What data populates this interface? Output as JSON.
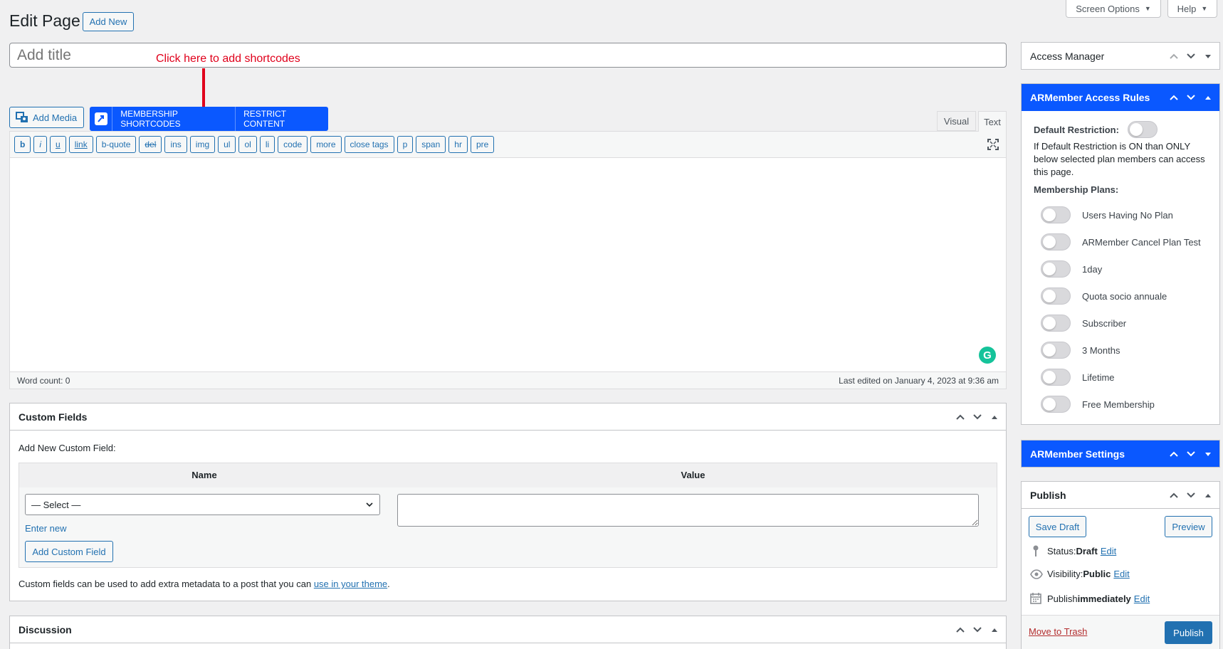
{
  "header": {
    "title": "Edit Page",
    "add_new": "Add New",
    "screen_options": "Screen Options",
    "help": "Help"
  },
  "title_input": {
    "placeholder": "Add title"
  },
  "annotation": {
    "text": "Click here to add shortcodes",
    "color": "#e0001b"
  },
  "toolbar": {
    "add_media": "Add Media",
    "membership_shortcodes": "MEMBERSHIP SHORTCODES",
    "restrict_content": "RESTRICT CONTENT",
    "tab_visual": "Visual",
    "tab_text": "Text",
    "quicktags": [
      "b",
      "i",
      "u",
      "link",
      "b-quote",
      "del",
      "ins",
      "img",
      "ul",
      "ol",
      "li",
      "code",
      "more",
      "close tags",
      "p",
      "span",
      "hr",
      "pre"
    ]
  },
  "editor": {
    "word_count": "Word count: 0",
    "last_edited": "Last edited on January 4, 2023 at 9:36 am"
  },
  "custom_fields": {
    "title": "Custom Fields",
    "add_new_label": "Add New Custom Field:",
    "col_name": "Name",
    "col_value": "Value",
    "select_value": "— Select —",
    "enter_new": "Enter new",
    "add_button": "Add Custom Field",
    "note_prefix": "Custom fields can be used to add extra metadata to a post that you can ",
    "note_link": "use in your theme",
    "note_suffix": "."
  },
  "discussion": {
    "title": "Discussion"
  },
  "access_manager": {
    "title": "Access Manager"
  },
  "access_rules": {
    "title": "ARMember Access Rules",
    "default_restriction_label": "Default Restriction:",
    "description": "If Default Restriction is ON than ONLY below selected plan members can access this page.",
    "plans_label": "Membership Plans:",
    "plans": [
      "Users Having No Plan",
      "ARMember Cancel Plan Test",
      "1day",
      "Quota socio annuale",
      "Subscriber",
      "3 Months",
      "Lifetime",
      "Free Membership"
    ]
  },
  "armember_settings": {
    "title": "ARMember Settings"
  },
  "publish": {
    "title": "Publish",
    "save_draft": "Save Draft",
    "preview": "Preview",
    "status_label": "Status: ",
    "status_value": "Draft",
    "visibility_label": "Visibility: ",
    "visibility_value": "Public",
    "publish_label": "Publish ",
    "publish_value": "immediately",
    "edit": "Edit",
    "move_to_trash": "Move to Trash",
    "publish_button": "Publish"
  },
  "colors": {
    "accent": "#2271b1",
    "armember_blue": "#0a58ff",
    "grammarly": "#15c39a",
    "trash": "#b32d2e"
  }
}
